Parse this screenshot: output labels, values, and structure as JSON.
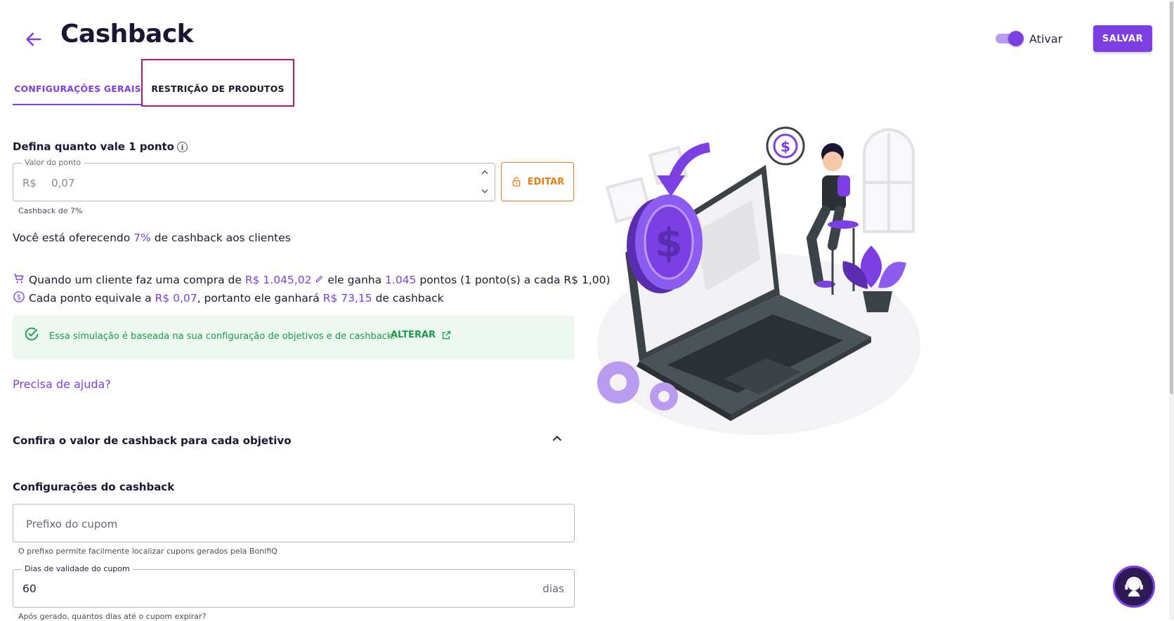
{
  "header": {
    "title": "Cashback",
    "toggle_label": "Ativar",
    "toggle_on": true,
    "save_label": "SALVAR"
  },
  "tabs": [
    {
      "label": "CONFIGURAÇÕES GERAIS",
      "active": true
    },
    {
      "label": "RESTRIÇÃO DE PRODUTOS",
      "active": false
    }
  ],
  "point_section": {
    "title": "Defina quanto vale 1 ponto",
    "field_legend": "Valor do ponto",
    "currency": "R$",
    "value": "0,07",
    "helper": "Cashback de 7%",
    "edit_label": "EDITAR"
  },
  "offer": {
    "prefix": "Você está oferecendo",
    "percent": "7%",
    "suffix": "de cashback aos clientes"
  },
  "purchase_line": {
    "t1": "Quando um cliente faz uma compra de",
    "amount": "R$ 1.045,02",
    "t2": "ele ganha",
    "points": "1.045",
    "t3": "pontos (1 ponto(s) a cada R$ 1,00)"
  },
  "point_line": {
    "t1": "Cada ponto equivale a",
    "point_value": "R$ 0,07",
    "t2": ", portanto ele ganhará",
    "cashback": "R$ 73,15",
    "t3": "de cashback"
  },
  "simulation": {
    "text": "Essa simulação é baseada na sua configuração de objetivos e de cashback.",
    "link": "ALTERAR"
  },
  "help_link": "Precisa de ajuda?",
  "objectives": {
    "title": "Confira o valor de cashback para cada objetivo"
  },
  "cashback_config": {
    "title": "Configurações do cashback",
    "prefix_placeholder": "Prefixo do cupom",
    "prefix_helper": "O prefixo permite facilmente localizar cupons gerados pela BonifiQ",
    "validity_legend": "Dias de validade do cupom",
    "validity_value": "60",
    "validity_unit": "dias",
    "validity_helper": "Após gerado, quantos dias até o cupom expirar?"
  },
  "colors": {
    "accent": "#7b3fe4",
    "orange": "#ef7d14",
    "success": "#1a9c4a",
    "highlight": "#b5186e"
  },
  "icons": [
    "back-arrow-icon",
    "info-icon",
    "chevron-up-icon",
    "chevron-down-icon",
    "lock-icon",
    "cart-icon",
    "dollar-circle-icon",
    "check-circle-icon",
    "external-link-icon",
    "pencil-icon",
    "support-agent-icon"
  ]
}
